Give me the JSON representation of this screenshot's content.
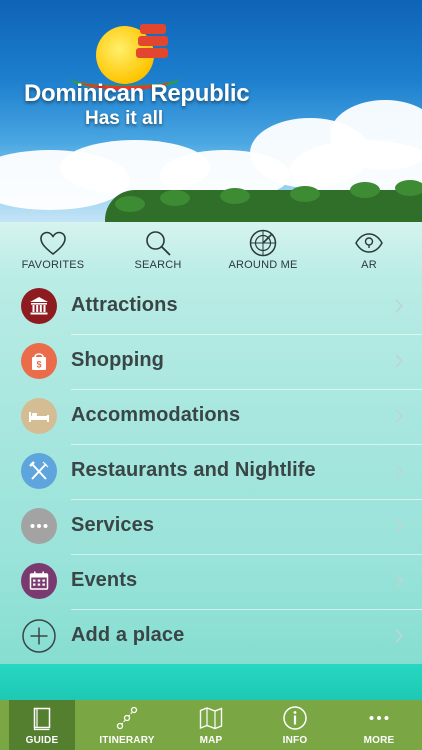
{
  "brand": {
    "title": "Dominican Republic",
    "tagline": "Has it all"
  },
  "quick_actions": [
    {
      "label": "FAVORITES",
      "icon": "heart-icon"
    },
    {
      "label": "SEARCH",
      "icon": "search-icon"
    },
    {
      "label": "AROUND ME",
      "icon": "radar-icon"
    },
    {
      "label": "AR",
      "icon": "eye-icon"
    }
  ],
  "categories": [
    {
      "label": "Attractions",
      "icon": "museum-icon",
      "color": "#8e1b20"
    },
    {
      "label": "Shopping",
      "icon": "shopping-bag-icon",
      "color": "#ea6c4a"
    },
    {
      "label": "Accommodations",
      "icon": "bed-icon",
      "color": "#d4bd93"
    },
    {
      "label": "Restaurants and Nightlife",
      "icon": "fork-knife-icon",
      "color": "#5fa5dd"
    },
    {
      "label": "Services",
      "icon": "more-dots-icon",
      "color": "#a3a3a3"
    },
    {
      "label": "Events",
      "icon": "calendar-icon",
      "color": "#7b3a6f"
    },
    {
      "label": "Add a place",
      "icon": "plus-icon",
      "color": "#3a4546"
    }
  ],
  "tabs": [
    {
      "label": "GUIDE",
      "icon": "book-icon",
      "active": true
    },
    {
      "label": "ITINERARY",
      "icon": "route-icon",
      "active": false
    },
    {
      "label": "MAP",
      "icon": "map-icon",
      "active": false
    },
    {
      "label": "INFO",
      "icon": "info-icon",
      "active": false
    },
    {
      "label": "MORE",
      "icon": "more-dots-icon",
      "active": false
    }
  ],
  "colors": {
    "tabbar": "#7aa744",
    "tab_active": "#547f2f",
    "text": "#3a4546"
  }
}
